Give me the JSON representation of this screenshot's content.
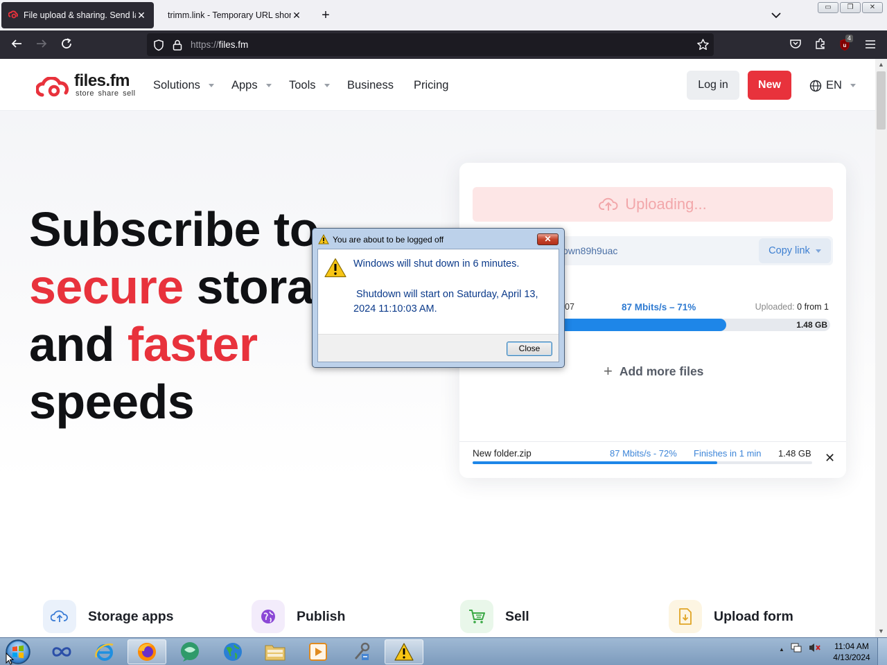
{
  "browser": {
    "tabs": [
      {
        "title": "File upload & sharing. Send large files",
        "active": true
      },
      {
        "title": "trimm.link - Temporary URL shortener",
        "active": false
      }
    ],
    "url_scheme": "https://",
    "url_host": "files.fm",
    "extension_badge": "4",
    "window_buttons": [
      "minimize",
      "restore",
      "close"
    ]
  },
  "site": {
    "logo": {
      "brand": "files.fm",
      "tagline": "store share sell"
    },
    "nav": {
      "solutions": "Solutions",
      "apps": "Apps",
      "tools": "Tools",
      "business": "Business",
      "pricing": "Pricing"
    },
    "login_label": "Log in",
    "new_label": "New",
    "language": "EN"
  },
  "hero": {
    "line1": "Subscribe to",
    "line2_red": "secure",
    "line2_rest": " storage",
    "line3_start": "and ",
    "line3_red": "faster",
    "line4": "speeds"
  },
  "upload_card": {
    "uploading_label": "Uploading...",
    "link_fragment": "own89h9uac",
    "copy_link_label": "Copy link",
    "progress": {
      "left_number": "07",
      "speed_text": "87 Mbits/s – 71%",
      "uploaded_label": "Uploaded:",
      "uploaded_value": "0 from 1",
      "percent": 71,
      "size": "1.48 GB"
    },
    "add_more_label": "Add more files",
    "file": {
      "name": "New folder.zip",
      "speed": "87 Mbits/s - 72%",
      "finishes": "Finishes in 1 min",
      "size": "1.48 GB",
      "percent": 72
    }
  },
  "features": [
    {
      "label": "Storage apps",
      "icon": "cloud-upload-icon",
      "color": "#eaf1fb"
    },
    {
      "label": "Publish",
      "icon": "globe-icon",
      "color": "#f3ecfb"
    },
    {
      "label": "Sell",
      "icon": "cart-icon",
      "color": "#e9f7ea"
    },
    {
      "label": "Upload form",
      "icon": "file-download-icon",
      "color": "#fdf5e2"
    }
  ],
  "dialog": {
    "title": "You are about to be logged off",
    "message1": "Windows will shut down in 6 minutes.",
    "message2": "Shutdown will start on Saturday, April 13, 2024 11:10:03 AM.",
    "close_label": "Close"
  },
  "taskbar": {
    "apps": [
      "start-orb",
      "infinity-app-icon",
      "internet-explorer-icon",
      "firefox-icon",
      "chat-app-icon",
      "globe-app-icon",
      "file-explorer-icon",
      "media-player-icon",
      "network-tools-icon",
      "warning-icon"
    ],
    "clock_time": "11:04 AM",
    "clock_date": "4/13/2024"
  },
  "colors": {
    "brand_red": "#e8323c",
    "link_blue": "#1e86e8",
    "browser_dark": "#2b2a33"
  }
}
